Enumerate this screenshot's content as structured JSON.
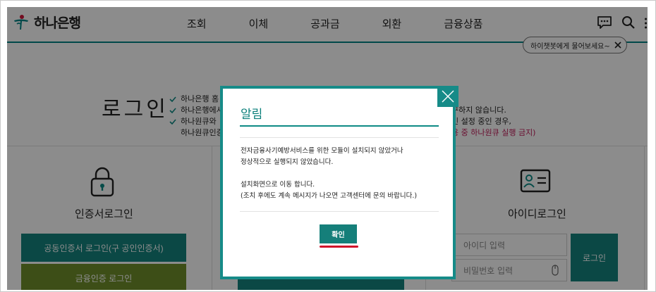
{
  "header": {
    "logo_text": "하나은행",
    "nav": [
      "조회",
      "이체",
      "공과금",
      "외환",
      "금융상품"
    ],
    "chat_tooltip": "하이챗봇에게 물어보세요~"
  },
  "login": {
    "title": "로그인",
    "notices_left": [
      "하나은행 홈",
      "하나은행에서",
      "하나원큐와",
      "하나원큐인증"
    ],
    "notices_right": [
      "구하지 않습니다.",
      "인 설정 중인 경우,",
      "용 중 하나원큐 실행 금지)"
    ],
    "cert_panel": {
      "title": "인증서로그인",
      "btn_cert": "공동인증서 로그인(구 공인인증서)",
      "btn_fin": "금융인증 로그인"
    },
    "id_panel": {
      "title": "아이디로그인",
      "id_placeholder": "아이디 입력",
      "pw_placeholder": "비밀번호 입력",
      "login_button": "로그인"
    }
  },
  "modal": {
    "title": "알림",
    "body_lines_1": [
      "전자금융사기예방서비스를 위한 모듈이 설치되지 않았거나",
      "정상적으로 실행되지 않았습니다."
    ],
    "body_lines_2": [
      "설치화면으로 이동 합니다.",
      "(조치 후에도 계속 메시지가 나오면 고객센터에 문의 바랍니다.)"
    ],
    "confirm_label": "확인"
  },
  "colors": {
    "brand": "#008485",
    "button_teal": "#14847f",
    "button_green": "#6f8f2a",
    "alert_red": "#d0102a"
  }
}
